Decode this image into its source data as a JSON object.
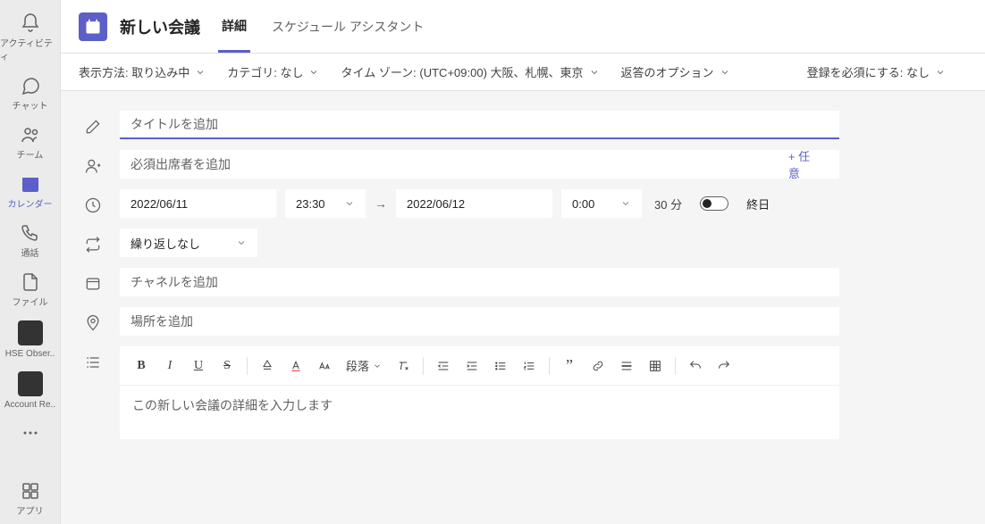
{
  "rail": {
    "items": [
      {
        "label": "アクティビティ"
      },
      {
        "label": "チャット"
      },
      {
        "label": "チーム"
      },
      {
        "label": "カレンダー"
      },
      {
        "label": "通話"
      },
      {
        "label": "ファイル"
      }
    ],
    "apps": [
      "HSE Obser..",
      "Account Re.."
    ],
    "apps_label": "アプリ"
  },
  "header": {
    "title": "新しい会議",
    "tabs": [
      "詳細",
      "スケジュール アシスタント"
    ]
  },
  "options": {
    "show_as": "表示方法: 取り込み中",
    "category": "カテゴリ: なし",
    "timezone": "タイム ゾーン: (UTC+09:00) 大阪、札幌、東京",
    "response": "返答のオプション",
    "registration": "登録を必須にする: なし"
  },
  "form": {
    "title_placeholder": "タイトルを追加",
    "attendee_placeholder": "必須出席者を追加",
    "optional_label": "+ 任意",
    "date_start": "2022/06/11",
    "time_start": "23:30",
    "date_end": "2022/06/12",
    "time_end": "0:00",
    "duration": "30 分",
    "allday": "終日",
    "recurrence": "繰り返しなし",
    "channel_placeholder": "チャネルを追加",
    "location_placeholder": "場所を追加",
    "rte_para": "段落",
    "rte_placeholder": "この新しい会議の詳細を入力します"
  }
}
